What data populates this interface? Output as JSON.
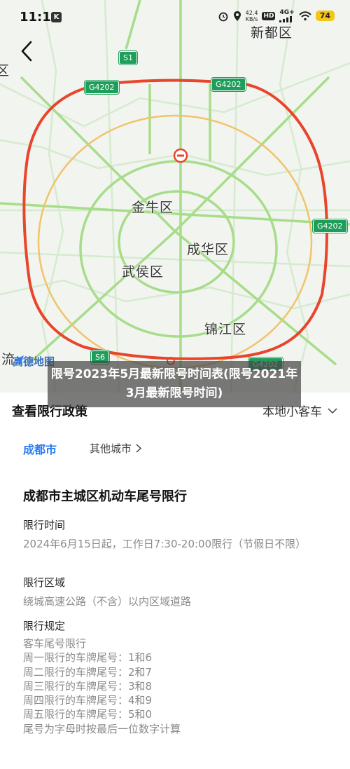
{
  "status_bar": {
    "time": "11:11",
    "app_badge": "K",
    "net_speed_value": "42.4",
    "net_speed_unit": "KB/s",
    "hd_label": "HD",
    "network_label": "4G+",
    "battery": "74",
    "icons": [
      "alarm-icon",
      "location-icon",
      "signal-icon",
      "wifi-icon",
      "battery-icon"
    ]
  },
  "map": {
    "districts": {
      "xindu": "新都区",
      "jinniu": "金牛区",
      "chenghua": "成华区",
      "wuhou": "武侯区",
      "jinjiang": "锦江区",
      "liu_partial": "流",
      "left_partial": "区"
    },
    "shields": {
      "s1": "S1",
      "g4202_a": "G4202",
      "g4202_b": "G4202",
      "g4202_c": "G4202",
      "g4202_d": "G4202",
      "s6": "S6"
    },
    "logo_text": "高德地图",
    "ring_color": "#e8452c",
    "road_color": "#a7dd8a"
  },
  "overlay": {
    "title": "限号2023年5月最新限号时间表(限号2021年3月最新限号时间)"
  },
  "policy": {
    "section_title": "查看限行政策",
    "vehicle_type": "本地小客车",
    "tab_active": "成都市",
    "tab_other": "其他城市",
    "accent_color": "#2b7bf3",
    "rule_title": "成都市主城区机动车尾号限行",
    "time_label": "限行时间",
    "time_value": "2024年6月15日起，工作日7:30-20:00限行（节假日不限）",
    "area_label": "限行区域",
    "area_value": "绕城高速公路（不含）以内区域道路",
    "rules_label": "限行规定",
    "rules": [
      "客车尾号限行",
      "周一限行的车牌尾号：1和6",
      "周二限行的车牌尾号：2和7",
      "周三限行的车牌尾号：3和8",
      "周四限行的车牌尾号：4和9",
      "周五限行的车牌尾号：5和0",
      "尾号为字母时按最后一位数字计算"
    ]
  }
}
